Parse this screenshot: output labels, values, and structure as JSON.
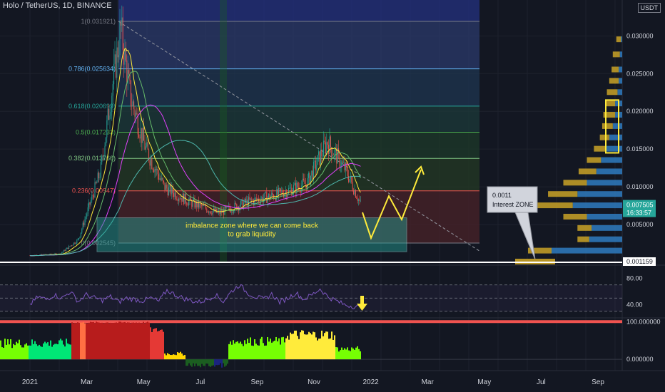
{
  "header": {
    "title": "Holo / TetherUS, 1D, BINANCE",
    "currency_badge": "USDT"
  },
  "colors": {
    "background": "#131722",
    "up": "#26a69a",
    "down": "#ef5350",
    "rsi": "#7e57c2",
    "accent_yellow": "#ffeb3b",
    "price_badge": "#26a69a"
  },
  "chart_data": [
    {
      "type": "candlestick",
      "title": "Holo / TetherUS, 1D, BINANCE",
      "x_axis": {
        "tick_labels": [
          "2021",
          "Mar",
          "May",
          "Jul",
          "Sep",
          "Nov",
          "2022",
          "Mar",
          "May",
          "Jul",
          "Sep"
        ]
      },
      "y_axis": {
        "tick_labels": [
          "0.030000",
          "0.025000",
          "0.020000",
          "0.015000",
          "0.010000",
          "0.005000"
        ],
        "range": [
          0.0,
          0.034
        ]
      },
      "price_labels": {
        "last": "0.007505",
        "countdown": "16:33:57",
        "level": "0.001159"
      },
      "approx_close_series": [
        {
          "date": "2021-01-01",
          "close": 0.0009
        },
        {
          "date": "2021-02-01",
          "close": 0.0011
        },
        {
          "date": "2021-02-20",
          "close": 0.003
        },
        {
          "date": "2021-03-15",
          "close": 0.012
        },
        {
          "date": "2021-04-05",
          "close": 0.031
        },
        {
          "date": "2021-04-15",
          "close": 0.022
        },
        {
          "date": "2021-05-01",
          "close": 0.015
        },
        {
          "date": "2021-05-20",
          "close": 0.01
        },
        {
          "date": "2021-06-15",
          "close": 0.008
        },
        {
          "date": "2021-07-15",
          "close": 0.0065
        },
        {
          "date": "2021-08-15",
          "close": 0.008
        },
        {
          "date": "2021-09-15",
          "close": 0.009
        },
        {
          "date": "2021-10-15",
          "close": 0.0105
        },
        {
          "date": "2021-11-05",
          "close": 0.016
        },
        {
          "date": "2021-11-25",
          "close": 0.012
        },
        {
          "date": "2021-12-10",
          "close": 0.0075
        }
      ],
      "fibonacci_levels": [
        {
          "label": "1(0.031921)",
          "value": 0.031921,
          "color": "#787b86"
        },
        {
          "label": "0.786(0.025634)",
          "value": 0.025634,
          "color": "#64b5f6"
        },
        {
          "label": "0.618(0.020699)",
          "value": 0.020699,
          "color": "#26a69a"
        },
        {
          "label": "0.5(0.017233)",
          "value": 0.017233,
          "color": "#4caf50"
        },
        {
          "label": "0.382(0.013766)",
          "value": 0.013766,
          "color": "#81c784"
        },
        {
          "label": "0.236(0.00947)",
          "value": 0.00947,
          "color": "#ef5350"
        },
        {
          "label": "0(0.002545)",
          "value": 0.002545,
          "color": "#787b86"
        }
      ],
      "annotations": {
        "imbalance_zone": "imbalance zone where we can come back to grab liquidity",
        "callout_value": "0.0011",
        "callout_label": "Interest ZONE"
      }
    },
    {
      "type": "line",
      "title": "",
      "y_axis": {
        "tick_labels": [
          "80.00",
          "40.00"
        ],
        "range": [
          20,
          100
        ]
      },
      "series": [
        {
          "values": [
            40,
            52,
            48,
            55,
            50,
            60,
            45,
            55,
            50,
            47,
            52,
            44,
            50,
            48,
            46,
            50,
            45,
            62,
            55,
            50,
            46,
            44,
            48,
            55,
            45,
            60,
            70,
            58,
            52,
            48,
            56,
            44,
            50,
            58,
            48,
            55,
            64,
            52,
            46,
            40,
            38,
            36
          ]
        }
      ]
    },
    {
      "type": "area",
      "title": "",
      "y_axis": {
        "tick_labels": [
          "100.000000",
          "0.000000"
        ],
        "range": [
          -30,
          110
        ]
      }
    }
  ]
}
